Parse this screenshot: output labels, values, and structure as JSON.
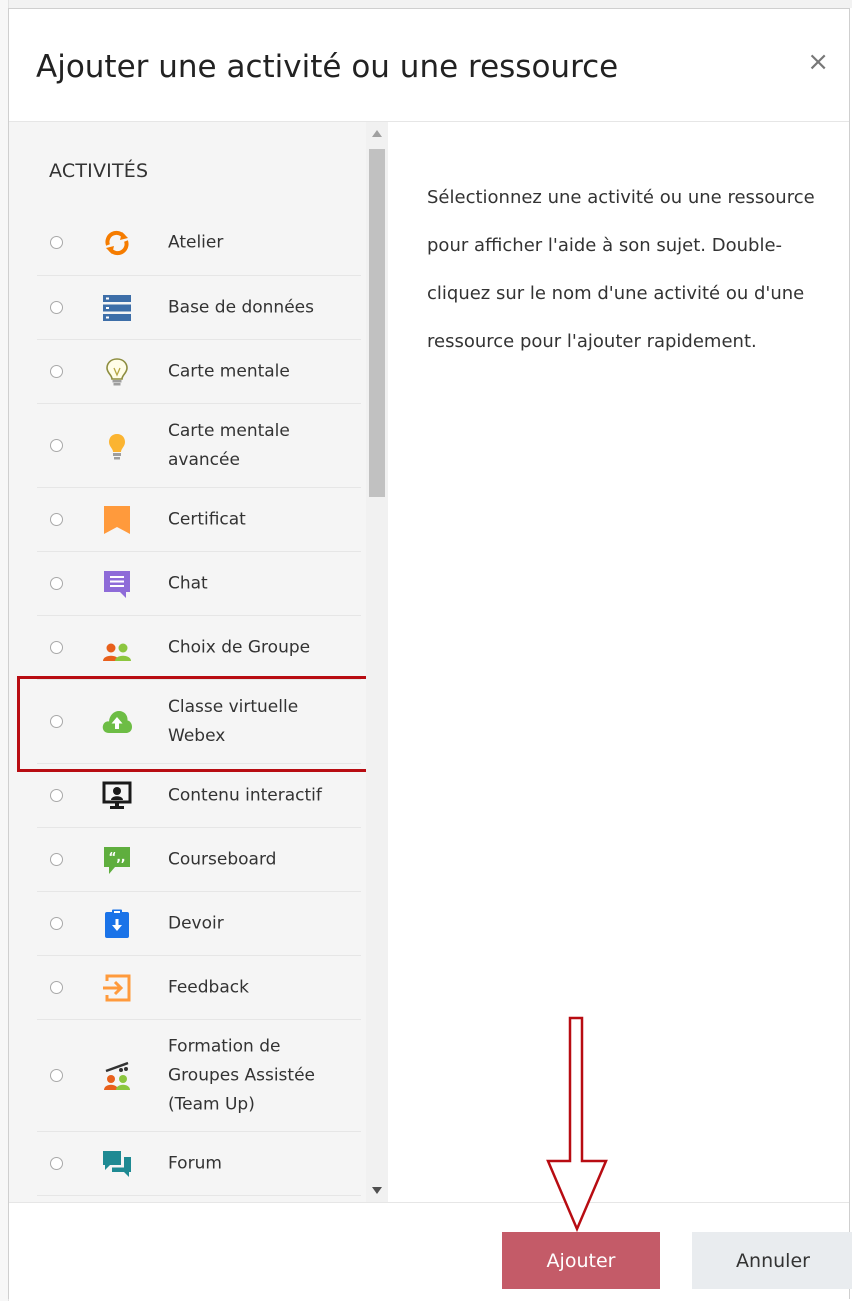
{
  "dialog": {
    "title": "Ajouter une activité ou une ressource",
    "close_glyph": "×"
  },
  "activities": {
    "section_title": "ACTIVITÉS",
    "items": [
      {
        "label": "Atelier",
        "icon": "workshop-icon"
      },
      {
        "label": "Base de données",
        "icon": "database-icon"
      },
      {
        "label": "Carte mentale",
        "icon": "lightbulb-outline-icon"
      },
      {
        "label": "Carte mentale avancée",
        "icon": "lightbulb-icon"
      },
      {
        "label": "Certificat",
        "icon": "certificate-icon"
      },
      {
        "label": "Chat",
        "icon": "chat-icon"
      },
      {
        "label": "Choix de Groupe",
        "icon": "group-choice-icon"
      },
      {
        "label": "Classe virtuelle Webex",
        "icon": "cloud-upload-icon",
        "highlighted": true
      },
      {
        "label": "Contenu interactif",
        "icon": "interactive-content-icon"
      },
      {
        "label": "Courseboard",
        "icon": "quote-bubble-icon"
      },
      {
        "label": "Devoir",
        "icon": "assignment-icon"
      },
      {
        "label": "Feedback",
        "icon": "feedback-icon"
      },
      {
        "label": "Formation de Groupes Assistée (Team Up)",
        "icon": "team-up-icon"
      },
      {
        "label": "Forum",
        "icon": "forum-icon"
      }
    ]
  },
  "help_text": "Sélectionnez une activité ou une ressource pour afficher l'aide à son sujet. Double-cliquez sur le nom d'une activité ou d'une ressource pour l'ajouter rapidement.",
  "footer": {
    "add_label": "Ajouter",
    "cancel_label": "Annuler"
  },
  "colors": {
    "primary_button": "#c45b68",
    "highlight_border": "#b80c12",
    "annotation_arrow": "#b80c12"
  }
}
